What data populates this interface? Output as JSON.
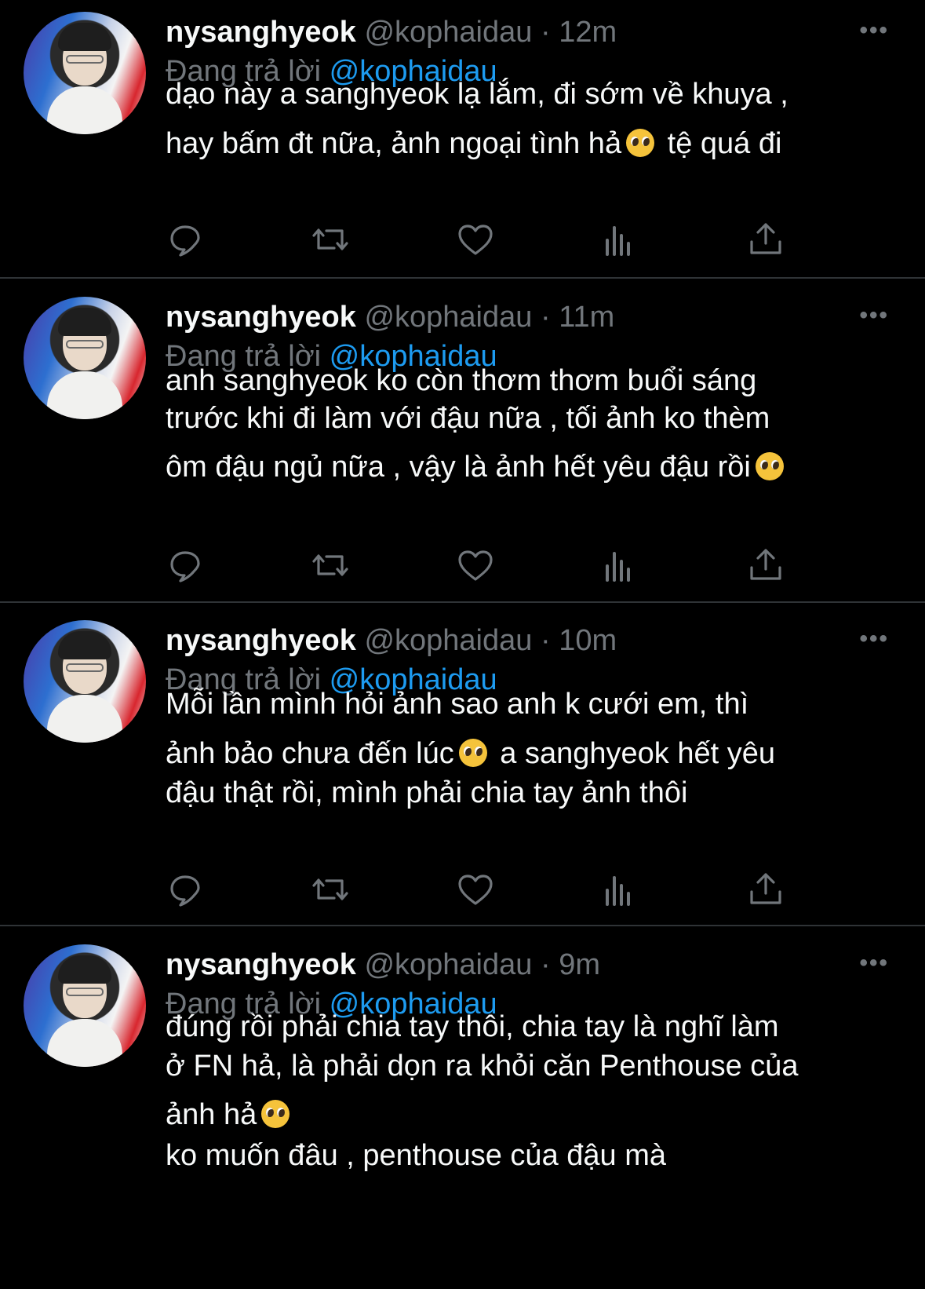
{
  "tweets": [
    {
      "name": "nysanghyeok",
      "handle": "@kophaidau",
      "time": "12m",
      "reply_prefix": "Đang trả lời",
      "reply_to": "@kophaidau",
      "lines": [
        {
          "text": "dạo này a sanghyeok lạ lắm, đi sớm về khuya ,",
          "after": ""
        },
        {
          "text": "hay bấm đt nữa, ảnh ngoại tình hả",
          "emoji": "pleading-face",
          "after": " tệ quá đi"
        }
      ]
    },
    {
      "name": "nysanghyeok",
      "handle": "@kophaidau",
      "time": "11m",
      "reply_prefix": "Đang trả lời",
      "reply_to": "@kophaidau",
      "lines": [
        {
          "text": "anh sanghyeok ko còn thơm thơm buổi sáng",
          "after": ""
        },
        {
          "text": "trước khi đi làm với đậu nữa , tối ảnh ko thèm",
          "after": ""
        },
        {
          "text": "ôm đậu ngủ nữa , vậy là ảnh hết yêu đậu rồi",
          "emoji": "pleading-face",
          "after": ""
        }
      ]
    },
    {
      "name": "nysanghyeok",
      "handle": "@kophaidau",
      "time": "10m",
      "reply_prefix": "Đang trả lời",
      "reply_to": "@kophaidau",
      "lines": [
        {
          "text": "Mỗi lần mình hỏi ảnh sao anh k cưới em, thì",
          "after": ""
        },
        {
          "text": "ảnh bảo chưa đến lúc",
          "emoji": "pleading-face",
          "after": " a sanghyeok hết yêu"
        },
        {
          "text": "đậu thật rồi, mình phải chia tay ảnh thôi",
          "after": ""
        }
      ]
    },
    {
      "name": "nysanghyeok",
      "handle": "@kophaidau",
      "time": "9m",
      "reply_prefix": "Đang trả lời",
      "reply_to": "@kophaidau",
      "lines": [
        {
          "text": "đúng rồi phải chia tay thôi, chia tay là nghĩ làm",
          "after": ""
        },
        {
          "text": "ở FN hả, là phải dọn ra khỏi căn Penthouse của",
          "after": ""
        },
        {
          "text": "ảnh hả",
          "emoji": "pleading-face",
          "after": ""
        },
        {
          "text": "ko muốn đâu , penthouse của đậu mà",
          "after": ""
        }
      ]
    }
  ],
  "icons": {
    "more": "more-icon",
    "reply": "reply-icon",
    "retweet": "retweet-icon",
    "like": "like-icon",
    "views": "views-icon",
    "share": "share-icon"
  },
  "colors": {
    "background": "#000000",
    "text": "#f7f9f9",
    "secondary": "#71767b",
    "mention": "#1d9bf0",
    "separator": "#2f3336"
  }
}
